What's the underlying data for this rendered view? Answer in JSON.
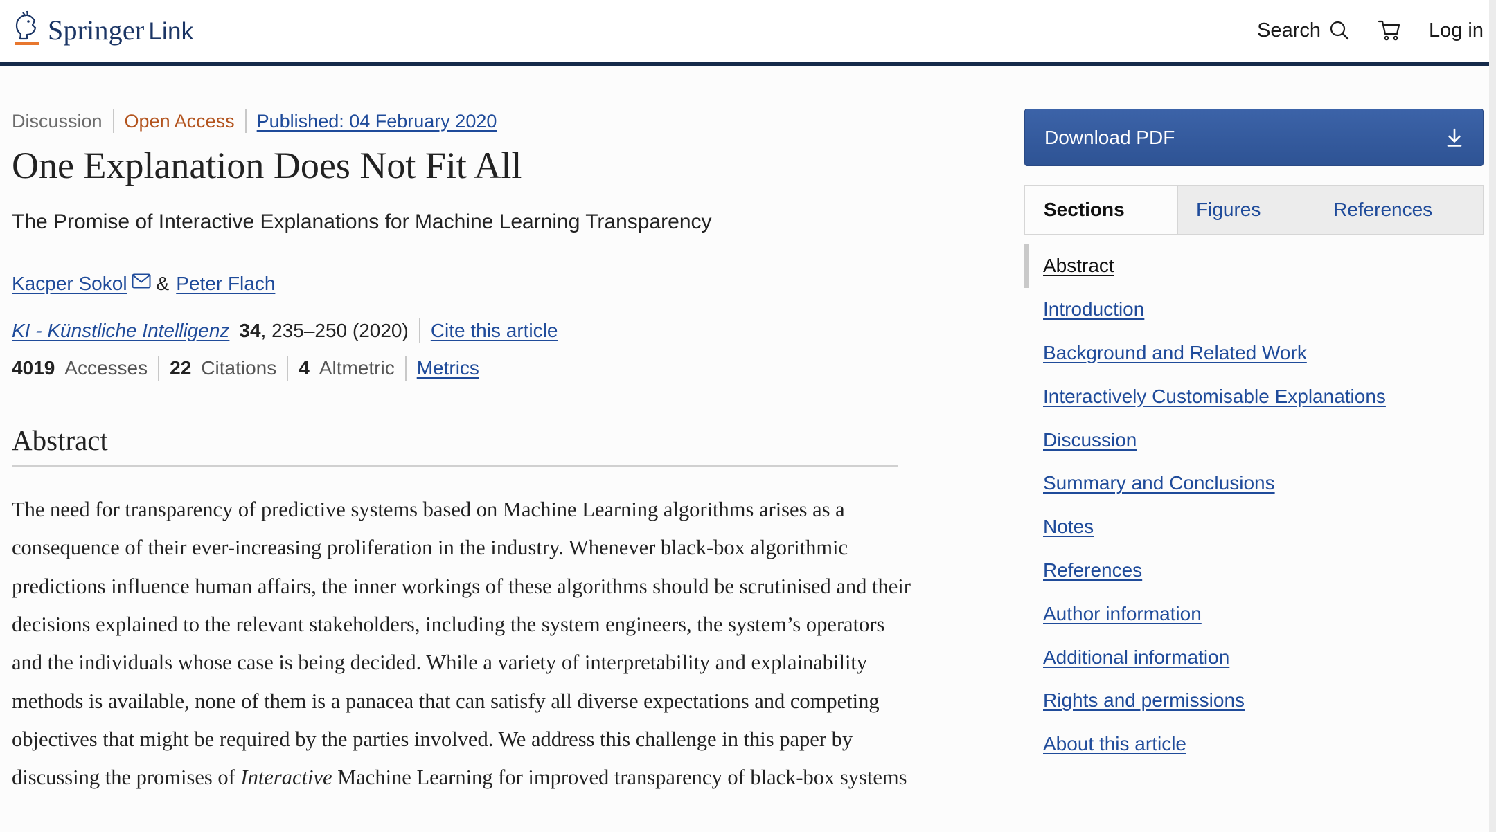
{
  "header": {
    "logo_main": "Springer",
    "logo_sub": "Link",
    "search_label": "Search",
    "login_label": "Log in",
    "icons": [
      "springer-horse-logo-icon",
      "search-icon",
      "cart-icon"
    ]
  },
  "article": {
    "type": "Discussion",
    "access": "Open Access",
    "published": "Published: 04 February 2020",
    "title": "One Explanation Does Not Fit All",
    "subtitle": "The Promise of Interactive Explanations for Machine Learning Transparency",
    "authors": [
      "Kacper Sokol",
      "Peter Flach"
    ],
    "author_sep": "&",
    "journal": "KI - Künstliche Intelligenz",
    "volume": "34",
    "pages_year": ", 235–250 (2020)",
    "cite_label": "Cite this article",
    "metrics": {
      "accesses_value": "4019",
      "accesses_label": "Accesses",
      "citations_value": "22",
      "citations_label": "Citations",
      "altmetric_value": "4",
      "altmetric_label": "Altmetric",
      "metrics_link": "Metrics"
    }
  },
  "abstract": {
    "heading": "Abstract",
    "text_before_em": "The need for transparency of predictive systems based on Machine Learning algorithms arises as a consequence of their ever-increasing proliferation in the industry. Whenever black-box algorithmic predictions influence human affairs, the inner workings of these algorithms should be scrutinised and their decisions explained to the relevant stakeholders, including the system engineers, the system’s operators and the individuals whose case is being decided. While a variety of interpretability and explainability methods is available, none of them is a panacea that can satisfy all diverse expectations and competing objectives that might be required by the parties involved. We address this challenge in this paper by discussing the promises of ",
    "em_word": "Interactive",
    "text_after_em": " Machine Learning for improved transparency of black-box systems"
  },
  "sidebar": {
    "download_label": "Download PDF",
    "tabs": [
      "Sections",
      "Figures",
      "References"
    ],
    "toc": [
      "Abstract",
      "Introduction",
      "Background and Related Work",
      "Interactively Customisable Explanations",
      "Discussion",
      "Summary and Conclusions",
      "Notes",
      "References",
      "Author information",
      "Additional information",
      "Rights and permissions",
      "About this article"
    ]
  },
  "colors": {
    "header_rule": "#152a4a",
    "link": "#1f4b9a",
    "open_access": "#b3541e",
    "button": "#2e5394"
  }
}
